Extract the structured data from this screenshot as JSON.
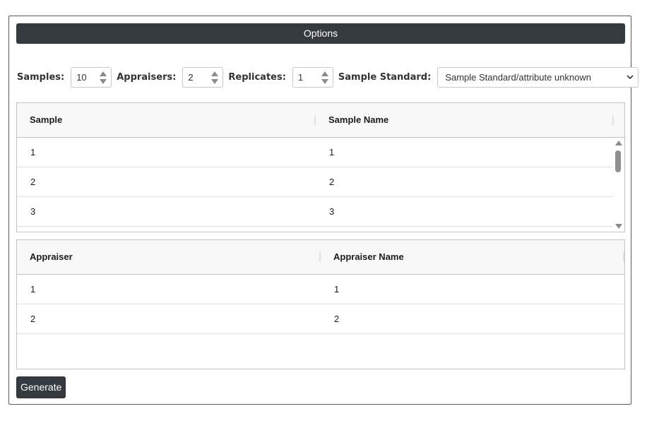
{
  "options": {
    "title": "Options"
  },
  "controls": {
    "samples_label": "Samples:",
    "samples_value": "10",
    "appraisers_label": "Appraisers:",
    "appraisers_value": "2",
    "replicates_label": "Replicates:",
    "replicates_value": "1",
    "sample_standard_label": "Sample Standard:",
    "sample_standard_value": "Sample Standard/attribute unknown"
  },
  "samples_grid": {
    "columns": [
      "Sample",
      "Sample Name"
    ],
    "rows": [
      [
        "1",
        "1"
      ],
      [
        "2",
        "2"
      ],
      [
        "3",
        "3"
      ]
    ]
  },
  "appraisers_grid": {
    "columns": [
      "Appraiser",
      "Appraiser Name"
    ],
    "rows": [
      [
        "1",
        "1"
      ],
      [
        "2",
        "2"
      ]
    ]
  },
  "actions": {
    "generate_label": "Generate"
  },
  "colors": {
    "accent_dark": "#343a40",
    "grid_border": "#bdc3c7",
    "header_bg": "#f8f8f8"
  },
  "icons": {
    "spinner_up": "chevron-up-icon",
    "spinner_down": "chevron-down-icon",
    "select_dropdown": "chevron-down-icon"
  }
}
